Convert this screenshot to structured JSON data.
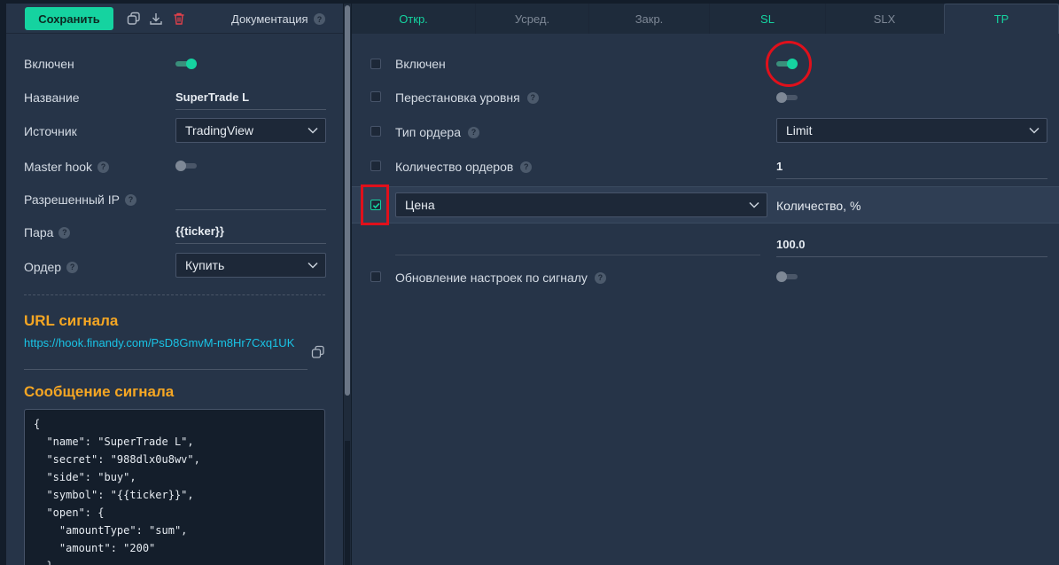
{
  "toolbar": {
    "save_label": "Сохранить",
    "docs_label": "Документация"
  },
  "left_form": {
    "enabled_label": "Включен",
    "enabled": true,
    "name_label": "Название",
    "name_value": "SuperTrade L",
    "source_label": "Источник",
    "source_value": "TradingView",
    "master_hook_label": "Master hook",
    "master_hook": false,
    "allowed_ip_label": "Разрешенный IP",
    "allowed_ip_value": "",
    "pair_label": "Пара",
    "pair_value": "{{ticker}}",
    "order_label": "Ордер",
    "order_value": "Купить"
  },
  "signal_url": {
    "title": "URL сигнала",
    "url": "https://hook.finandy.com/PsD8GmvM-m8Hr7Cxq1UK"
  },
  "signal_message": {
    "title": "Сообщение сигнала",
    "code": "{\n  \"name\": \"SuperTrade L\",\n  \"secret\": \"988dlx0u8wv\",\n  \"side\": \"buy\",\n  \"symbol\": \"{{ticker}}\",\n  \"open\": {\n    \"amountType\": \"sum\",\n    \"amount\": \"200\"\n  },"
  },
  "tabs": [
    {
      "label": "Откр.",
      "active": false
    },
    {
      "label": "Усред.",
      "active": false
    },
    {
      "label": "Закр.",
      "active": false
    },
    {
      "label": "SL",
      "active": false
    },
    {
      "label": "SLX",
      "active": false
    },
    {
      "label": "TP",
      "active": true
    }
  ],
  "tp_form": {
    "enabled_label": "Включен",
    "enabled": true,
    "level_swap_label": "Перестановка уровня",
    "level_swap": false,
    "order_type_label": "Тип ордера",
    "order_type_value": "Limit",
    "order_count_label": "Количество ордеров",
    "order_count_value": "1",
    "price_select_value": "Цена",
    "price_checked": true,
    "quantity_label": "Количество, %",
    "quantity_value": "100.0",
    "signal_update_label": "Обновление настроек по сигналу",
    "signal_update": false
  },
  "colors": {
    "accent": "#15d3a0",
    "annotation": "#e0101b",
    "section_title": "#f5a623",
    "link": "#19c4e6"
  }
}
